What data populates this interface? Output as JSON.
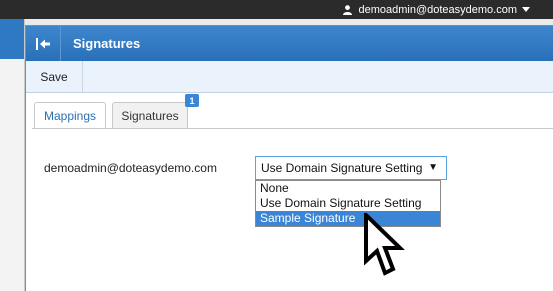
{
  "header": {
    "username": "demoadmin@doteasydemo.com",
    "user_icon": "user-icon",
    "caret_icon": "caret-down-icon"
  },
  "dialog": {
    "title": "Signatures",
    "collapse_icon": "collapse-left-icon"
  },
  "toolbar": {
    "save_label": "Save"
  },
  "tabs": [
    {
      "label": "Mappings",
      "active": true
    },
    {
      "label": "Signatures",
      "active": false,
      "badge": "1"
    }
  ],
  "mapping": {
    "email": "demoadmin@doteasydemo.com",
    "selected_value": "Use Domain Signature Setting",
    "dropdown_open": true,
    "options": [
      {
        "label": "None",
        "highlighted": false
      },
      {
        "label": "Use Domain Signature Setting",
        "highlighted": false
      },
      {
        "label": "Sample Signature",
        "highlighted": true
      }
    ]
  },
  "colors": {
    "titlebar": "#2e79c2",
    "highlight": "#3a85d6",
    "topbar": "#2b2b2b"
  }
}
